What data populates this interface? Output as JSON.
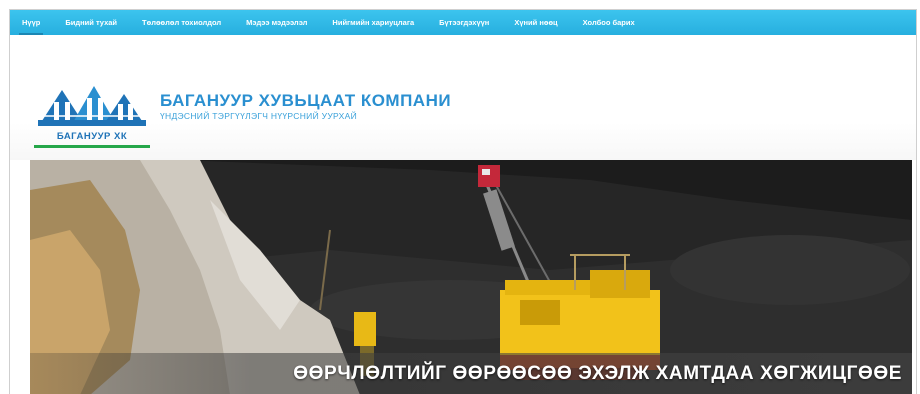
{
  "nav": {
    "items": [
      {
        "label": "Нүүр",
        "active": true
      },
      {
        "label": "Бидний тухай"
      },
      {
        "label": "Төлөөлөл тохиолдол"
      },
      {
        "label": "Мэдээ мэдээлэл"
      },
      {
        "label": "Нийгмийн хариуцлага"
      },
      {
        "label": "Бүтээгдэхүүн"
      },
      {
        "label": "Хүний нөөц"
      },
      {
        "label": "Холбоо барих"
      }
    ]
  },
  "header": {
    "logo_caption": "БАГАНУУР ХК",
    "logo_icon": "baganuur-logo",
    "company_name": "БАГАНУУР ХУВЬЦААТ КОМПАНИ",
    "company_subtitle": "ҮНДЭСНИЙ ТЭРГҮҮЛЭГЧ НҮҮРСНИЙ УУРХАЙ"
  },
  "hero": {
    "caption": "ӨӨРЧЛӨЛТИЙГ ӨӨРӨӨСӨӨ ЭХЭЛЖ ХАМТДАА ХӨГЖИЦГӨӨЕ"
  },
  "colors": {
    "nav_bg": "#2fb7e6",
    "brand_blue": "#2a8fd0",
    "brand_green": "#26a74a",
    "excavator_yellow": "#f2c21a"
  }
}
